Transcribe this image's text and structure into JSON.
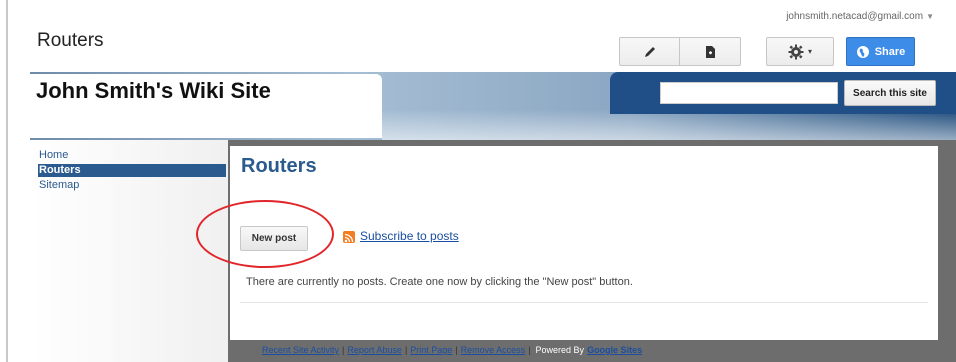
{
  "page": {
    "name": "Routers"
  },
  "account": {
    "email": "johnsmith.netacad@gmail.com",
    "caret": "▼"
  },
  "toolbar": {
    "edit_icon": "pencil-icon",
    "new_page_icon": "new-page-icon",
    "settings_icon": "gear-icon",
    "settings_caret": "▾",
    "share_label": "Share"
  },
  "site": {
    "title": "John Smith's Wiki Site",
    "search_button_label": "Search this site",
    "search_value": ""
  },
  "sidebar": {
    "items": [
      {
        "label": "Home",
        "active": false
      },
      {
        "label": "Routers",
        "active": true
      },
      {
        "label": "Sitemap",
        "active": false
      }
    ]
  },
  "content": {
    "title": "Routers",
    "new_post_label": "New post",
    "subscribe_label": "Subscribe to posts",
    "empty_message": "There are currently no posts. Create one now by clicking the \"New post\" button."
  },
  "footer": {
    "links": [
      "Recent Site Activity",
      "Report Abuse",
      "Print Page",
      "Remove Access"
    ],
    "powered_by": "Powered By",
    "google_sites": "Google Sites"
  },
  "colors": {
    "link": "#1a4ea0",
    "nav_active": "#2b5a8e",
    "share": "#3c8ce8",
    "highlight": "#e1252a"
  }
}
